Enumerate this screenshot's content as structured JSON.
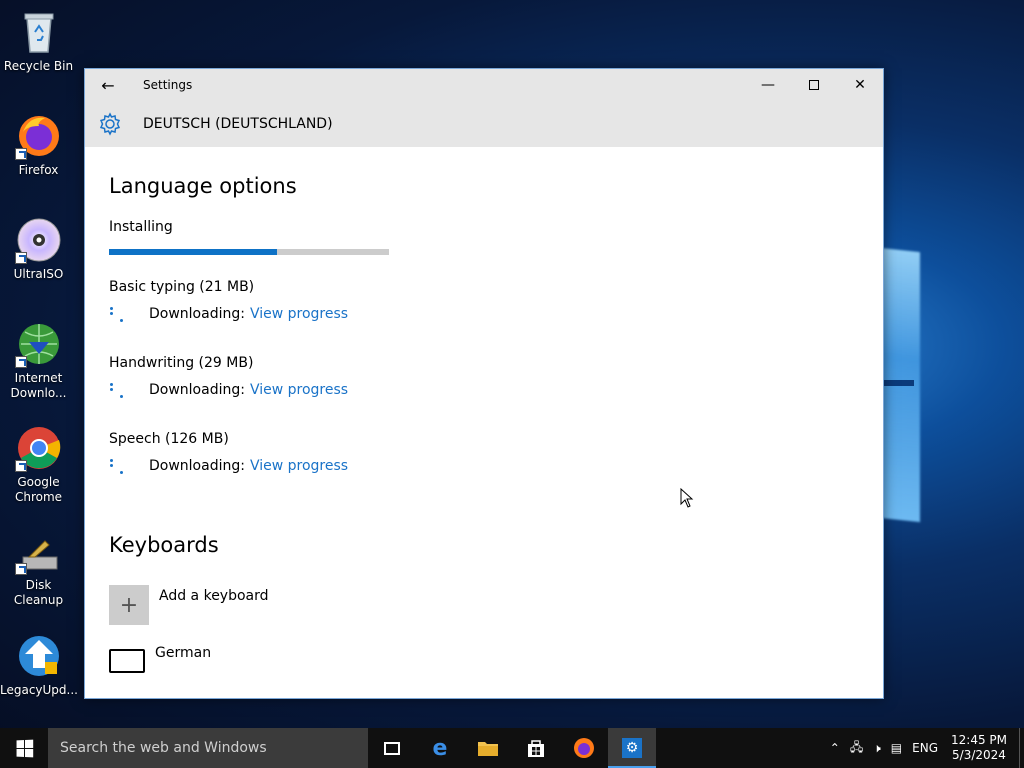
{
  "desktop": {
    "icons": [
      {
        "label": "Recycle Bin"
      },
      {
        "label": "Firefox"
      },
      {
        "label": "UltraISO"
      },
      {
        "label": "Internet Downlo..."
      },
      {
        "label": "Google Chrome"
      },
      {
        "label": "Disk Cleanup"
      },
      {
        "label": "LegacyUpd..."
      }
    ]
  },
  "window": {
    "title": "Settings",
    "header": "DEUTSCH (DEUTSCHLAND)",
    "language_options": {
      "heading": "Language options",
      "status": "Installing",
      "progress": 0.6,
      "features": [
        {
          "name": "Basic typing (21 MB)",
          "status": "Downloading:",
          "link": "View progress"
        },
        {
          "name": "Handwriting (29 MB)",
          "status": "Downloading:",
          "link": "View progress"
        },
        {
          "name": "Speech (126 MB)",
          "status": "Downloading:",
          "link": "View progress"
        }
      ]
    },
    "keyboards": {
      "heading": "Keyboards",
      "add_label": "Add a keyboard",
      "items": [
        {
          "name": "German"
        }
      ]
    }
  },
  "taskbar": {
    "search_placeholder": "Search the web and Windows",
    "tray": {
      "language": "ENG",
      "time": "12:45 PM",
      "date": "5/3/2024"
    }
  },
  "colors": {
    "accent": "#1a73c8",
    "header_bg": "#e6e6e6",
    "taskbar_bg": "#101010"
  }
}
